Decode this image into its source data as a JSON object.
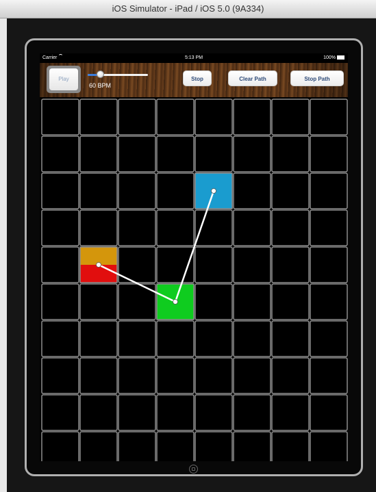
{
  "window": {
    "title": "iOS Simulator - iPad / iOS 5.0 (9A334)"
  },
  "statusbar": {
    "carrier": "Carrier",
    "time": "5:13 PM",
    "battery": "100%"
  },
  "toolbar": {
    "play_label": "Play",
    "tempo_label": "60 BPM",
    "tempo_slider_fraction": 0.2,
    "stop_label": "Stop",
    "clear_path_label": "Clear Path",
    "stop_path_label": "Stop Path"
  },
  "grid": {
    "columns": 8,
    "rows_visible": 10,
    "cells": [
      {
        "col": 4,
        "row": 2,
        "color": "#1a9ccf",
        "name": "cell-blue"
      },
      {
        "col": 1,
        "row": 4,
        "color": "#d4960c",
        "color2": "#e10e0e",
        "name": "cell-orange-red"
      },
      {
        "col": 3,
        "row": 5,
        "color": "#0fcc1f",
        "name": "cell-green"
      }
    ],
    "path": [
      {
        "col": 1,
        "row": 4
      },
      {
        "col": 3,
        "row": 5
      },
      {
        "col": 4,
        "row": 2
      }
    ]
  },
  "icons": [
    "wifi-icon",
    "battery-icon",
    "home-button-icon"
  ]
}
